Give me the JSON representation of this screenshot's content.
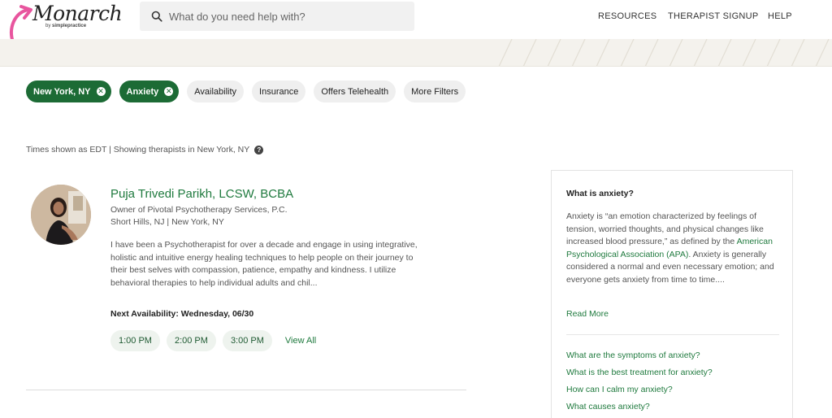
{
  "brand": {
    "name": "Monarch",
    "byline_prefix": "by",
    "byline_company": "simplepractice",
    "accent_color": "#e8559e"
  },
  "search": {
    "placeholder": "What do you need help with?"
  },
  "nav": {
    "resources": "RESOURCES",
    "therapist_signup": "THERAPIST SIGNUP",
    "help": "HELP"
  },
  "filters": {
    "active": [
      {
        "label": "New York, NY",
        "icon": "close-icon"
      },
      {
        "label": "Anxiety",
        "icon": "close-icon"
      }
    ],
    "options": [
      "Availability",
      "Insurance",
      "Offers Telehealth",
      "More Filters"
    ],
    "active_color": "#1c6b35"
  },
  "results_note": "Times shown as EDT | Showing therapists in New York, NY",
  "therapist": {
    "name": "Puja Trivedi Parikh, LCSW, BCBA",
    "title": "Owner of Pivotal Psychotherapy Services, P.C.",
    "location": "Short Hills, NJ | New York, NY",
    "bio": "I have been a Psychotherapist for over a decade and engage in using integrative, holistic and intuitive energy healing techniques to help people on their journey to their best selves with compassion, patience, empathy and kindness. I utilize behavioral therapies to help individual adults and chil...",
    "availability": "Next Availability: Wednesday, 06/30",
    "slots": [
      "1:00 PM",
      "2:00 PM",
      "3:00 PM"
    ],
    "view_all": "View All"
  },
  "sidebar": {
    "title": "What is anxiety?",
    "body_before": "Anxiety is “an emotion characterized by feelings of tension, worried thoughts, and physical changes like increased blood pressure,” as defined by the ",
    "body_link": "American Psychological Association (APA)",
    "body_after": ". Anxiety is generally considered a normal and even necessary emotion; and everyone gets anxiety from time to time....",
    "read_more": "Read More",
    "faqs": [
      "What are the symptoms of anxiety?",
      "What is the best treatment for anxiety?",
      "How can I calm my anxiety?",
      "What causes anxiety?"
    ]
  }
}
